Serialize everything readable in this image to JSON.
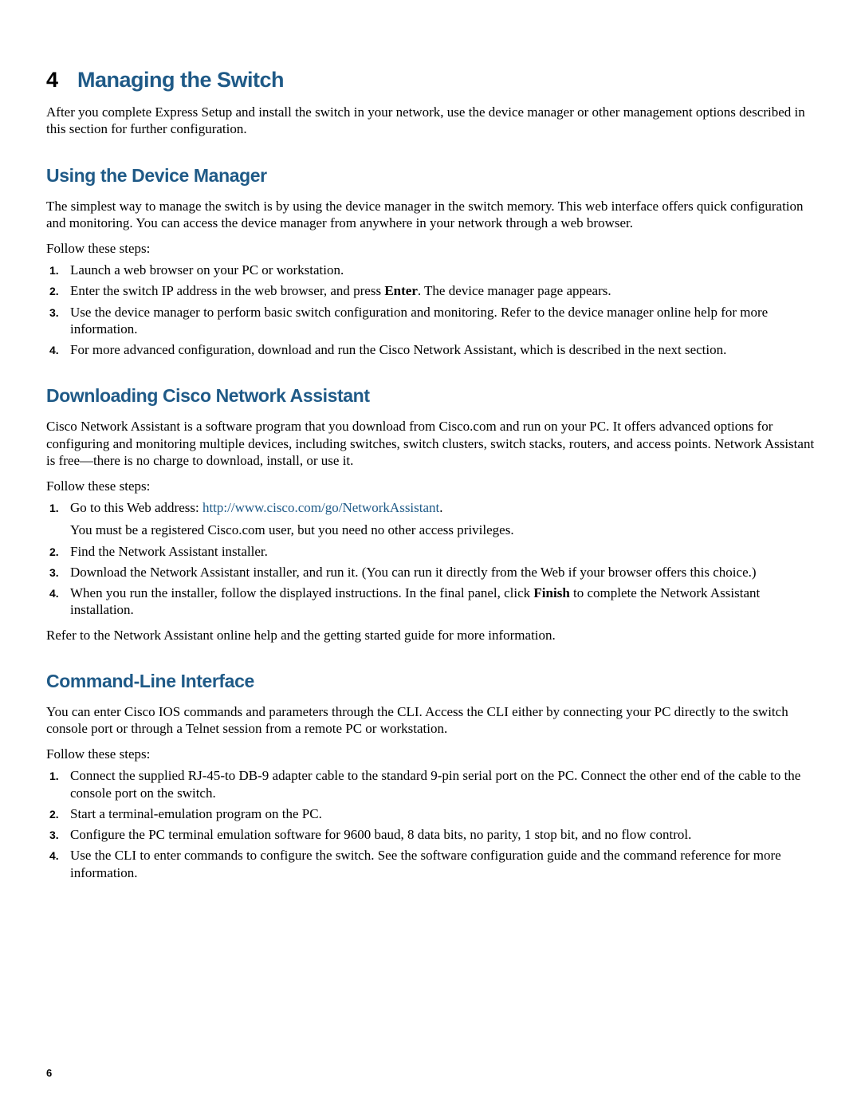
{
  "pageNumber": "6",
  "section": {
    "number": "4",
    "title": "Managing the Switch",
    "intro": "After you complete Express Setup and install the switch in your network, use the device manager or other management options described in this section for further configuration."
  },
  "deviceManager": {
    "heading": "Using the Device Manager",
    "intro": "The simplest way to manage the switch is by using the device manager in the switch memory. This web interface offers quick configuration and monitoring. You can access the device manager from anywhere in your network through a web browser.",
    "follow": "Follow these steps:",
    "steps": [
      "Launch a web browser on your PC or workstation.",
      {
        "pre": "Enter the switch IP address in the web browser, and press ",
        "bold": "Enter",
        "post": ". The device manager page appears."
      },
      "Use the device manager to perform basic switch configuration and monitoring. Refer to the device manager online help for more information.",
      "For more advanced configuration, download and run the Cisco Network Assistant, which is described in the next section."
    ]
  },
  "cna": {
    "heading": "Downloading Cisco Network Assistant",
    "intro": "Cisco Network Assistant is a software program that you download from Cisco.com and run on your PC. It offers advanced options for configuring and monitoring multiple devices, including switches, switch clusters, switch stacks, routers, and access points. Network Assistant is free—there is no charge to download, install, or use it.",
    "follow": "Follow these steps:",
    "step1_pre": "Go to this Web address: ",
    "step1_link": "http://www.cisco.com/go/NetworkAssistant",
    "step1_post": ".",
    "step1_sub": "You must be a registered Cisco.com user, but you need no other access privileges.",
    "step2": "Find the Network Assistant installer.",
    "step3": "Download the Network Assistant installer, and run it. (You can run it directly from the Web if your browser offers this choice.)",
    "step4_pre": "When you run the installer, follow the displayed instructions. In the final panel, click ",
    "step4_bold": "Finish",
    "step4_post": " to complete the Network Assistant installation.",
    "after": "Refer to the Network Assistant online help and the getting started guide for more information."
  },
  "cli": {
    "heading": "Command-Line Interface",
    "intro": "You can enter Cisco IOS commands and parameters through the CLI. Access the CLI either by connecting your PC directly to the switch console port or through a Telnet session from a remote PC or workstation.",
    "follow": "Follow these steps:",
    "steps": [
      "Connect the supplied RJ-45-to DB-9 adapter cable to the standard 9-pin serial port on the PC. Connect the other end of the cable to the console port on the switch.",
      "Start a terminal-emulation program on the PC.",
      "Configure the PC terminal emulation software for 9600 baud, 8 data bits, no parity, 1 stop bit, and no flow control.",
      "Use the CLI to enter commands to configure the switch. See the software configuration guide and the command reference for more information."
    ]
  }
}
